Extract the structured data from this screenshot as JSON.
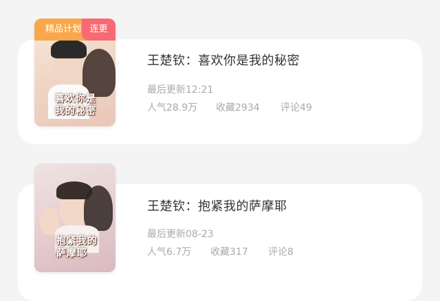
{
  "books": [
    {
      "tag_program": "精品计划",
      "tag_status": "连更",
      "cover_title": "喜欢你是我的秘密",
      "title": "王楚钦：喜欢你是我的秘密",
      "updated": "最后更新12:21",
      "popularity": "人气28.9万",
      "favorites": "收藏2934",
      "comments": "评论49"
    },
    {
      "cover_title": "抱紧我的萨摩耶",
      "title": "王楚钦：抱紧我的萨摩耶",
      "updated": "最后更新08-23",
      "popularity": "人气6.7万",
      "favorites": "收藏317",
      "comments": "评论8"
    }
  ],
  "colors": {
    "tag_program_bg": "#f8a84a",
    "tag_status_bg": "#f76a72",
    "card_bg": "#ffffff",
    "page_bg": "#f4f4f5"
  }
}
